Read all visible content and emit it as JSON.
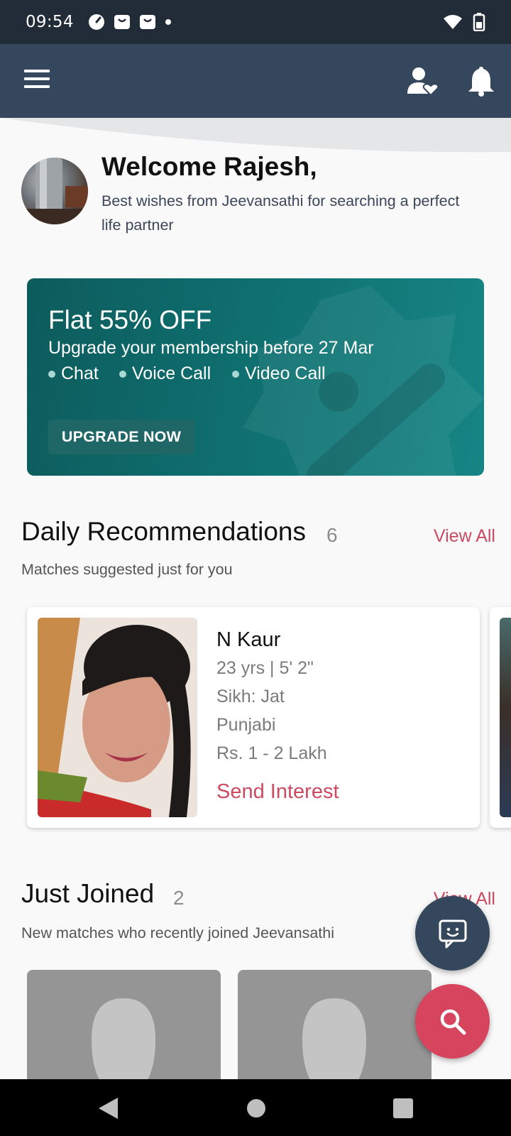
{
  "status_bar": {
    "time": "09:54",
    "icons": [
      "speedometer-icon",
      "bag-icon",
      "bag-icon",
      "dot-icon",
      "wifi-icon",
      "battery-icon"
    ]
  },
  "app_bar": {
    "icons": [
      "menu-icon",
      "match-heart-icon",
      "bell-icon"
    ]
  },
  "welcome": {
    "title": "Welcome Rajesh,",
    "subtitle": "Best wishes from Jeevansathi for searching a perfect life partner"
  },
  "promo": {
    "title": "Flat 55% OFF",
    "subtitle": "Upgrade your membership before 27 Mar",
    "features": [
      "Chat",
      "Voice Call",
      "Video Call"
    ],
    "button_label": "UPGRADE NOW"
  },
  "daily_recommendations": {
    "title": "Daily Recommendations",
    "count": "6",
    "view_all": "View All",
    "subtitle": "Matches suggested just for you",
    "card": {
      "name": "N Kaur",
      "age_height": "23  yrs | 5' 2\"",
      "religion": "Sikh: Jat",
      "language": "Punjabi",
      "income": "Rs. 1 - 2 Lakh",
      "action": "Send Interest"
    }
  },
  "just_joined": {
    "title": "Just Joined",
    "count": "2",
    "view_all": "View All",
    "subtitle": "New matches who recently joined Jeevansathi"
  },
  "fabs": {
    "chat_icon": "chat-bot-icon",
    "search_icon": "search-icon"
  },
  "colors": {
    "status_bar": "#222b38",
    "app_bar": "#34475c",
    "accent": "#cc4a62",
    "promo_teal": "#0f6e6e",
    "search_fab": "#d6445e"
  }
}
